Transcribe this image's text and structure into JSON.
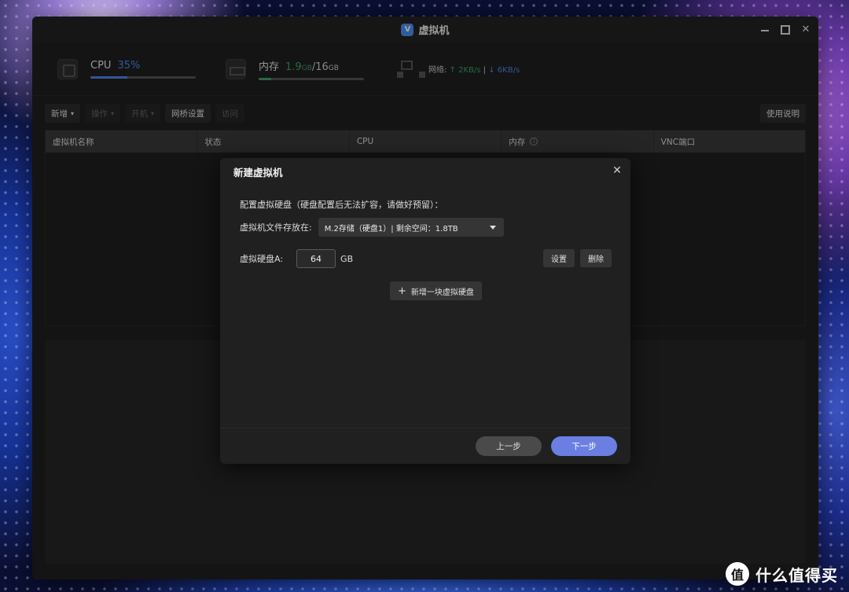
{
  "window": {
    "title": "虚拟机"
  },
  "stats": {
    "cpu": {
      "label": "CPU",
      "value": "35%",
      "percent": 35
    },
    "memory": {
      "label": "内存",
      "used": "1.9",
      "used_unit": "GB",
      "sep": "/",
      "total": "16",
      "total_unit": "GB",
      "percent": 12
    },
    "network": {
      "label": "网络:",
      "up": "↑ 2KB/s",
      "divider": "|",
      "down": "↓ 6KB/s"
    }
  },
  "toolbar": {
    "new": "新增",
    "operate": "操作",
    "power": "开机",
    "bridge": "网桥设置",
    "access": "访问",
    "help": "使用说明"
  },
  "table": {
    "columns": [
      "虚拟机名称",
      "状态",
      "CPU",
      "内存",
      "VNC端口"
    ]
  },
  "dialog": {
    "title": "新建虚拟机",
    "hint": "配置虚拟硬盘（硬盘配置后无法扩容，请做好预留）：",
    "location_label": "虚拟机文件存放在:",
    "location_value": "M.2存储（硬盘1）| 剩余空间：1.8TB",
    "disk_label": "虚拟硬盘A:",
    "disk_size": "64",
    "disk_unit": "GB",
    "settings_btn": "设置",
    "delete_btn": "删除",
    "add_disk_btn": "新增一块虚拟硬盘",
    "prev_btn": "上一步",
    "next_btn": "下一步"
  },
  "watermark": {
    "text": "什么值得买",
    "logo": "值"
  }
}
